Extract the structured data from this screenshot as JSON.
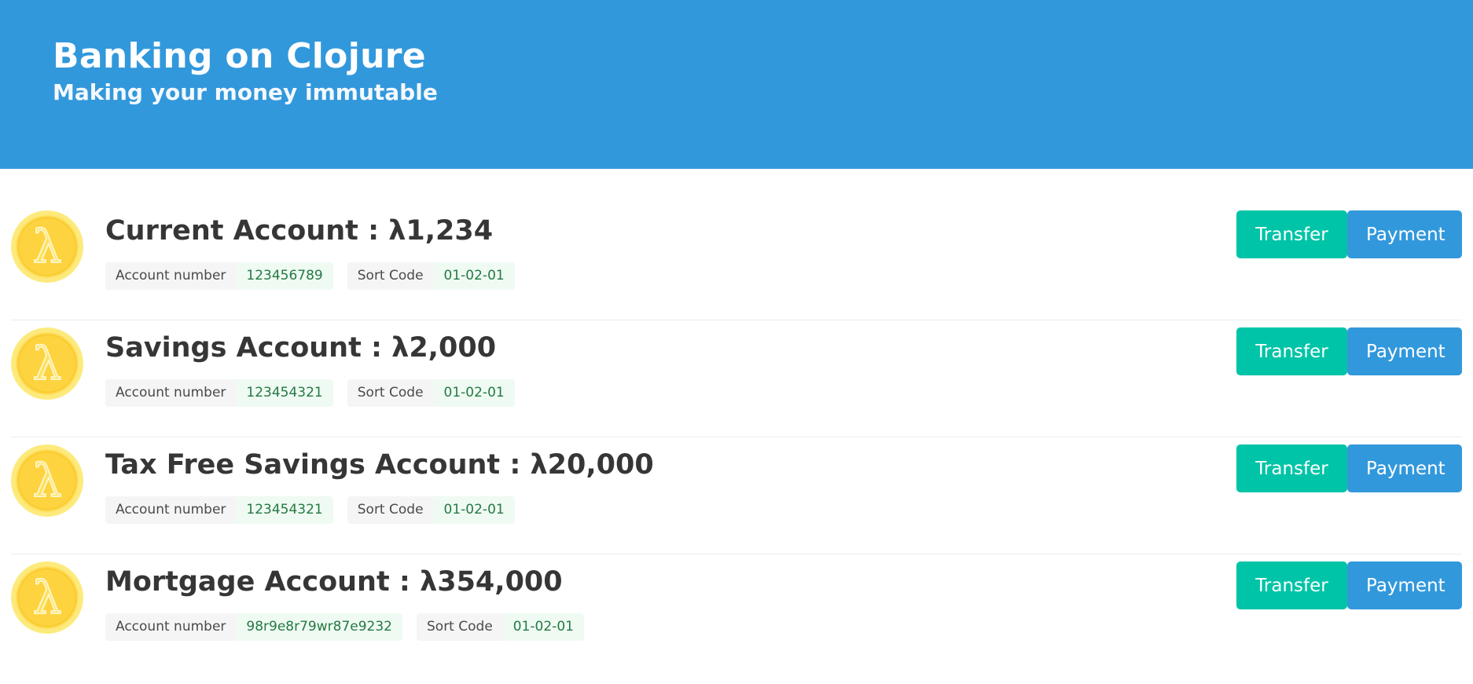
{
  "header": {
    "title": "Banking on Clojure",
    "subtitle": "Making your money immutable"
  },
  "accounts": [
    {
      "heading": "Current Account : λ1,234",
      "icon": "lambda-coin-icon",
      "account_number_label": "Account number",
      "account_number": "123456789",
      "sort_code_label": "Sort Code",
      "sort_code": "01-02-01",
      "transfer_label": "Transfer",
      "payment_label": "Payment"
    },
    {
      "heading": "Savings Account : λ2,000",
      "icon": "lambda-coin-icon",
      "account_number_label": "Account number",
      "account_number": "123454321",
      "sort_code_label": "Sort Code",
      "sort_code": "01-02-01",
      "transfer_label": "Transfer",
      "payment_label": "Payment"
    },
    {
      "heading": "Tax Free Savings Account : λ20,000",
      "icon": "lambda-coin-icon",
      "account_number_label": "Account number",
      "account_number": "123454321",
      "sort_code_label": "Sort Code",
      "sort_code": "01-02-01",
      "transfer_label": "Transfer",
      "payment_label": "Payment"
    },
    {
      "heading": "Mortgage Account : λ354,000",
      "icon": "lambda-coin-icon",
      "account_number_label": "Account number",
      "account_number": "98r9e8r79wr87e9232",
      "sort_code_label": "Sort Code",
      "sort_code": "01-02-01",
      "transfer_label": "Transfer",
      "payment_label": "Payment"
    }
  ],
  "colors": {
    "hero": "#3298dc",
    "transfer_button": "#00c4a7",
    "payment_button": "#3298dc",
    "tag_value_text": "#257942",
    "coin": "#fdd33f"
  }
}
